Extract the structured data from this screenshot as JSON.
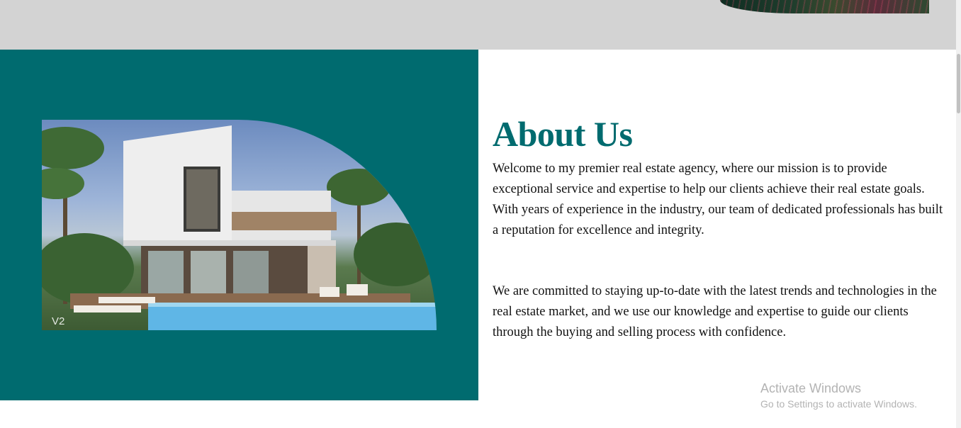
{
  "about": {
    "title": "About Us",
    "paragraph_1": "Welcome to my premier real estate agency, where our mission is to provide exceptional service and expertise to help our clients achieve their real estate goals. With years of experience in the industry, our team of dedicated professionals has built a reputation for excellence and integrity.",
    "paragraph_2": "We are committed to staying up-to-date with the latest trends and technologies in the real estate market, and we use our knowledge and expertise to guide our clients through the buying and selling process with confidence.",
    "image_watermark": "V2"
  },
  "colors": {
    "accent": "#006b6f",
    "top_band": "#d3d3d3",
    "text": "#111111"
  },
  "os_watermark": {
    "title": "Activate Windows",
    "subtitle": "Go to Settings to activate Windows."
  }
}
